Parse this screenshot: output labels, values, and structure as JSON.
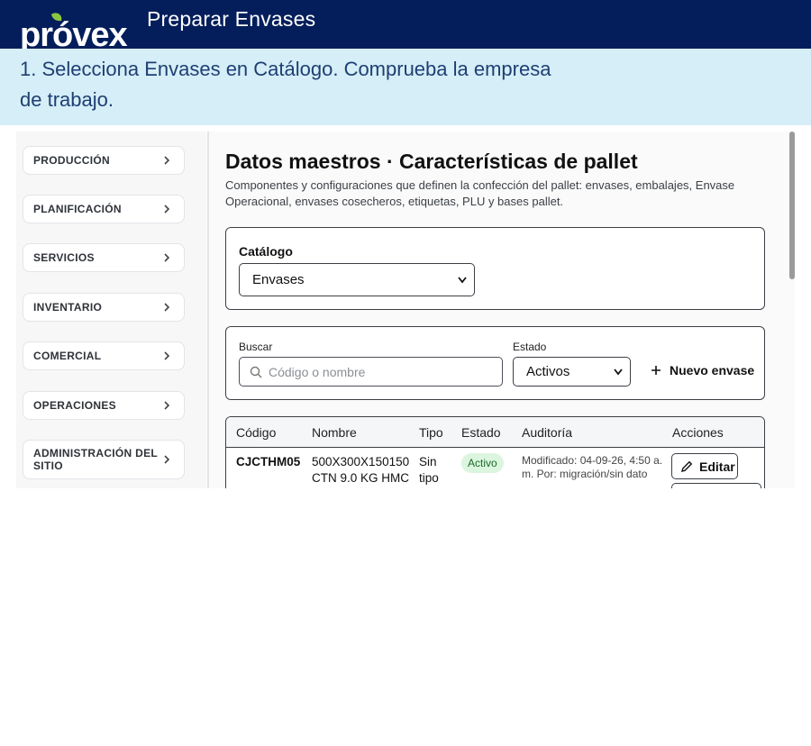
{
  "header": {
    "logo_text": "próvex",
    "title": "Preparar Envases"
  },
  "instruction": {
    "text": "1. Selecciona Envases en Catálogo. Comprueba la empresa de trabajo."
  },
  "sidebar": {
    "items": [
      {
        "label": "PRODUCCIÓN"
      },
      {
        "label": "PLANIFICACIÓN"
      },
      {
        "label": "SERVICIOS"
      },
      {
        "label": "INVENTARIO"
      },
      {
        "label": "COMERCIAL"
      },
      {
        "label": "OPERACIONES"
      },
      {
        "label": "ADMINISTRACIÓN DEL SITIO"
      }
    ]
  },
  "main": {
    "title": "Datos maestros · Características de pallet",
    "subtitle": "Componentes y configuraciones que definen la confección del pallet: envases, embalajes, Envase Operacional, envases cosecheros, etiquetas, PLU y bases pallet.",
    "catalog": {
      "label": "Catálogo",
      "selected": "Envases"
    },
    "filters": {
      "search_label": "Buscar",
      "search_placeholder": "Código o nombre",
      "state_label": "Estado",
      "state_selected": "Activos",
      "new_button": "Nuevo envase"
    },
    "table": {
      "headers": [
        "Código",
        "Nombre",
        "Tipo",
        "Estado",
        "Auditoría",
        "Acciones"
      ],
      "rows": [
        {
          "codigo": "CJCTHM05",
          "nombre": "500X300X150150 CTN 9.0 KG HMC",
          "tipo": "Sin tipo",
          "estado": "Activo",
          "auditoria": "Modificado: 04-09-26, 4:50 a. m. Por: migración/sin dato",
          "accion": "Editar"
        }
      ]
    }
  },
  "colors": {
    "header_bg": "#041e5b",
    "instruction_bg": "#d6eef7",
    "instruction_text": "#1e3f73",
    "badge_bg": "#dcf5df",
    "badge_text": "#1c6b2a",
    "logo_accent": "#8cc63f"
  },
  "icons": [
    "chevron-right-icon",
    "search-icon",
    "plus-icon",
    "pencil-icon",
    "chevron-down-icon"
  ]
}
